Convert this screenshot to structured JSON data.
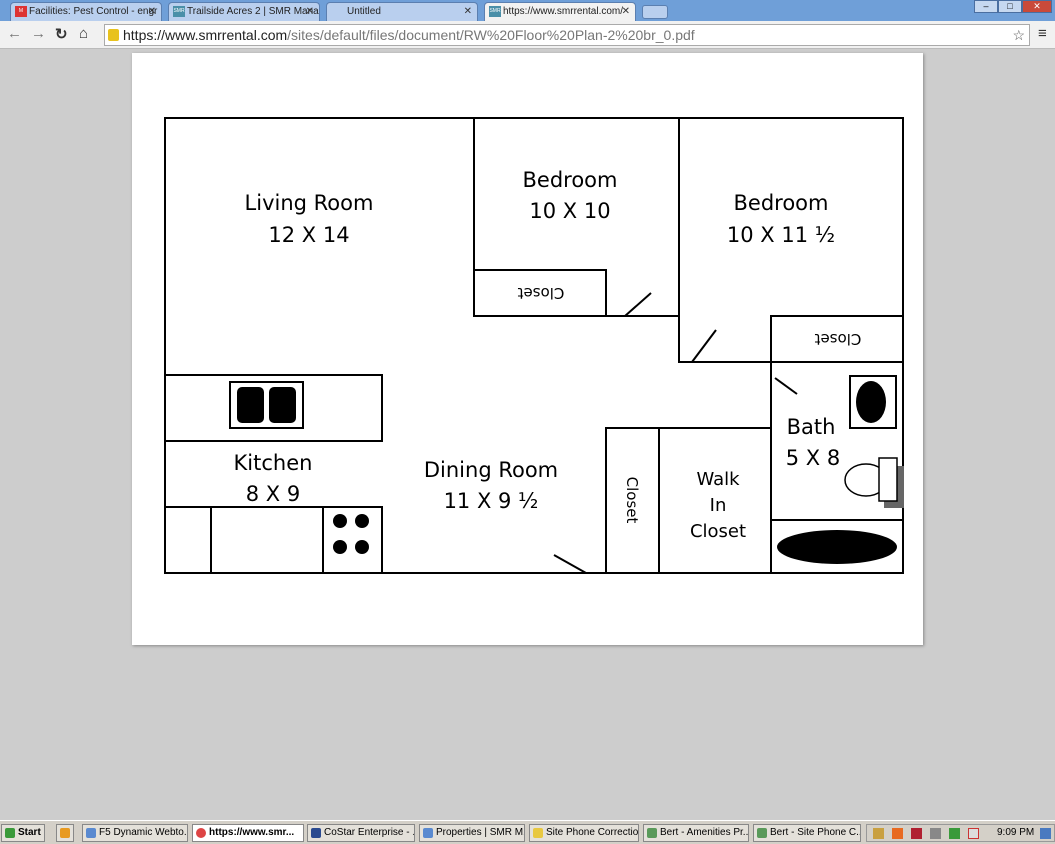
{
  "browser": {
    "tabs": [
      {
        "label": "Facilities: Pest Control - engr",
        "icon": "gmail-icon"
      },
      {
        "label": "Trailside Acres 2 | SMR Mana",
        "icon": "smr-icon"
      },
      {
        "label": "Untitled",
        "icon": ""
      },
      {
        "label": "https://www.smrrental.com/",
        "icon": "smr-icon",
        "active": true
      }
    ],
    "url_domain": "https://www.smrrental.com",
    "url_path": "/sites/default/files/document/RW%20Floor%20Plan-2%20br_0.pdf"
  },
  "floor_plan": {
    "rooms": [
      {
        "name": "Living Room",
        "size": "12 X 14"
      },
      {
        "name": "Bedroom",
        "size": "10 X 10"
      },
      {
        "name": "Bedroom",
        "size": "10 X 11 ½"
      },
      {
        "name": "Kitchen",
        "size": "8 X 9"
      },
      {
        "name": "Dining Room",
        "size": "11 X 9 ½"
      },
      {
        "name": "Bath",
        "size": "5 X 8"
      }
    ],
    "closet_label": "Closet",
    "walk_in": [
      "Walk",
      "In",
      "Closet"
    ]
  },
  "taskbar": {
    "start": "Start",
    "items": [
      "F5 Dynamic Webto...",
      "https://www.smr...",
      "CoStar Enterprise - ...",
      "Properties | SMR M...",
      "Site Phone Correction",
      "Bert - Amenities Pr...",
      "Bert - Site Phone C..."
    ],
    "clock": "9:09 PM"
  }
}
